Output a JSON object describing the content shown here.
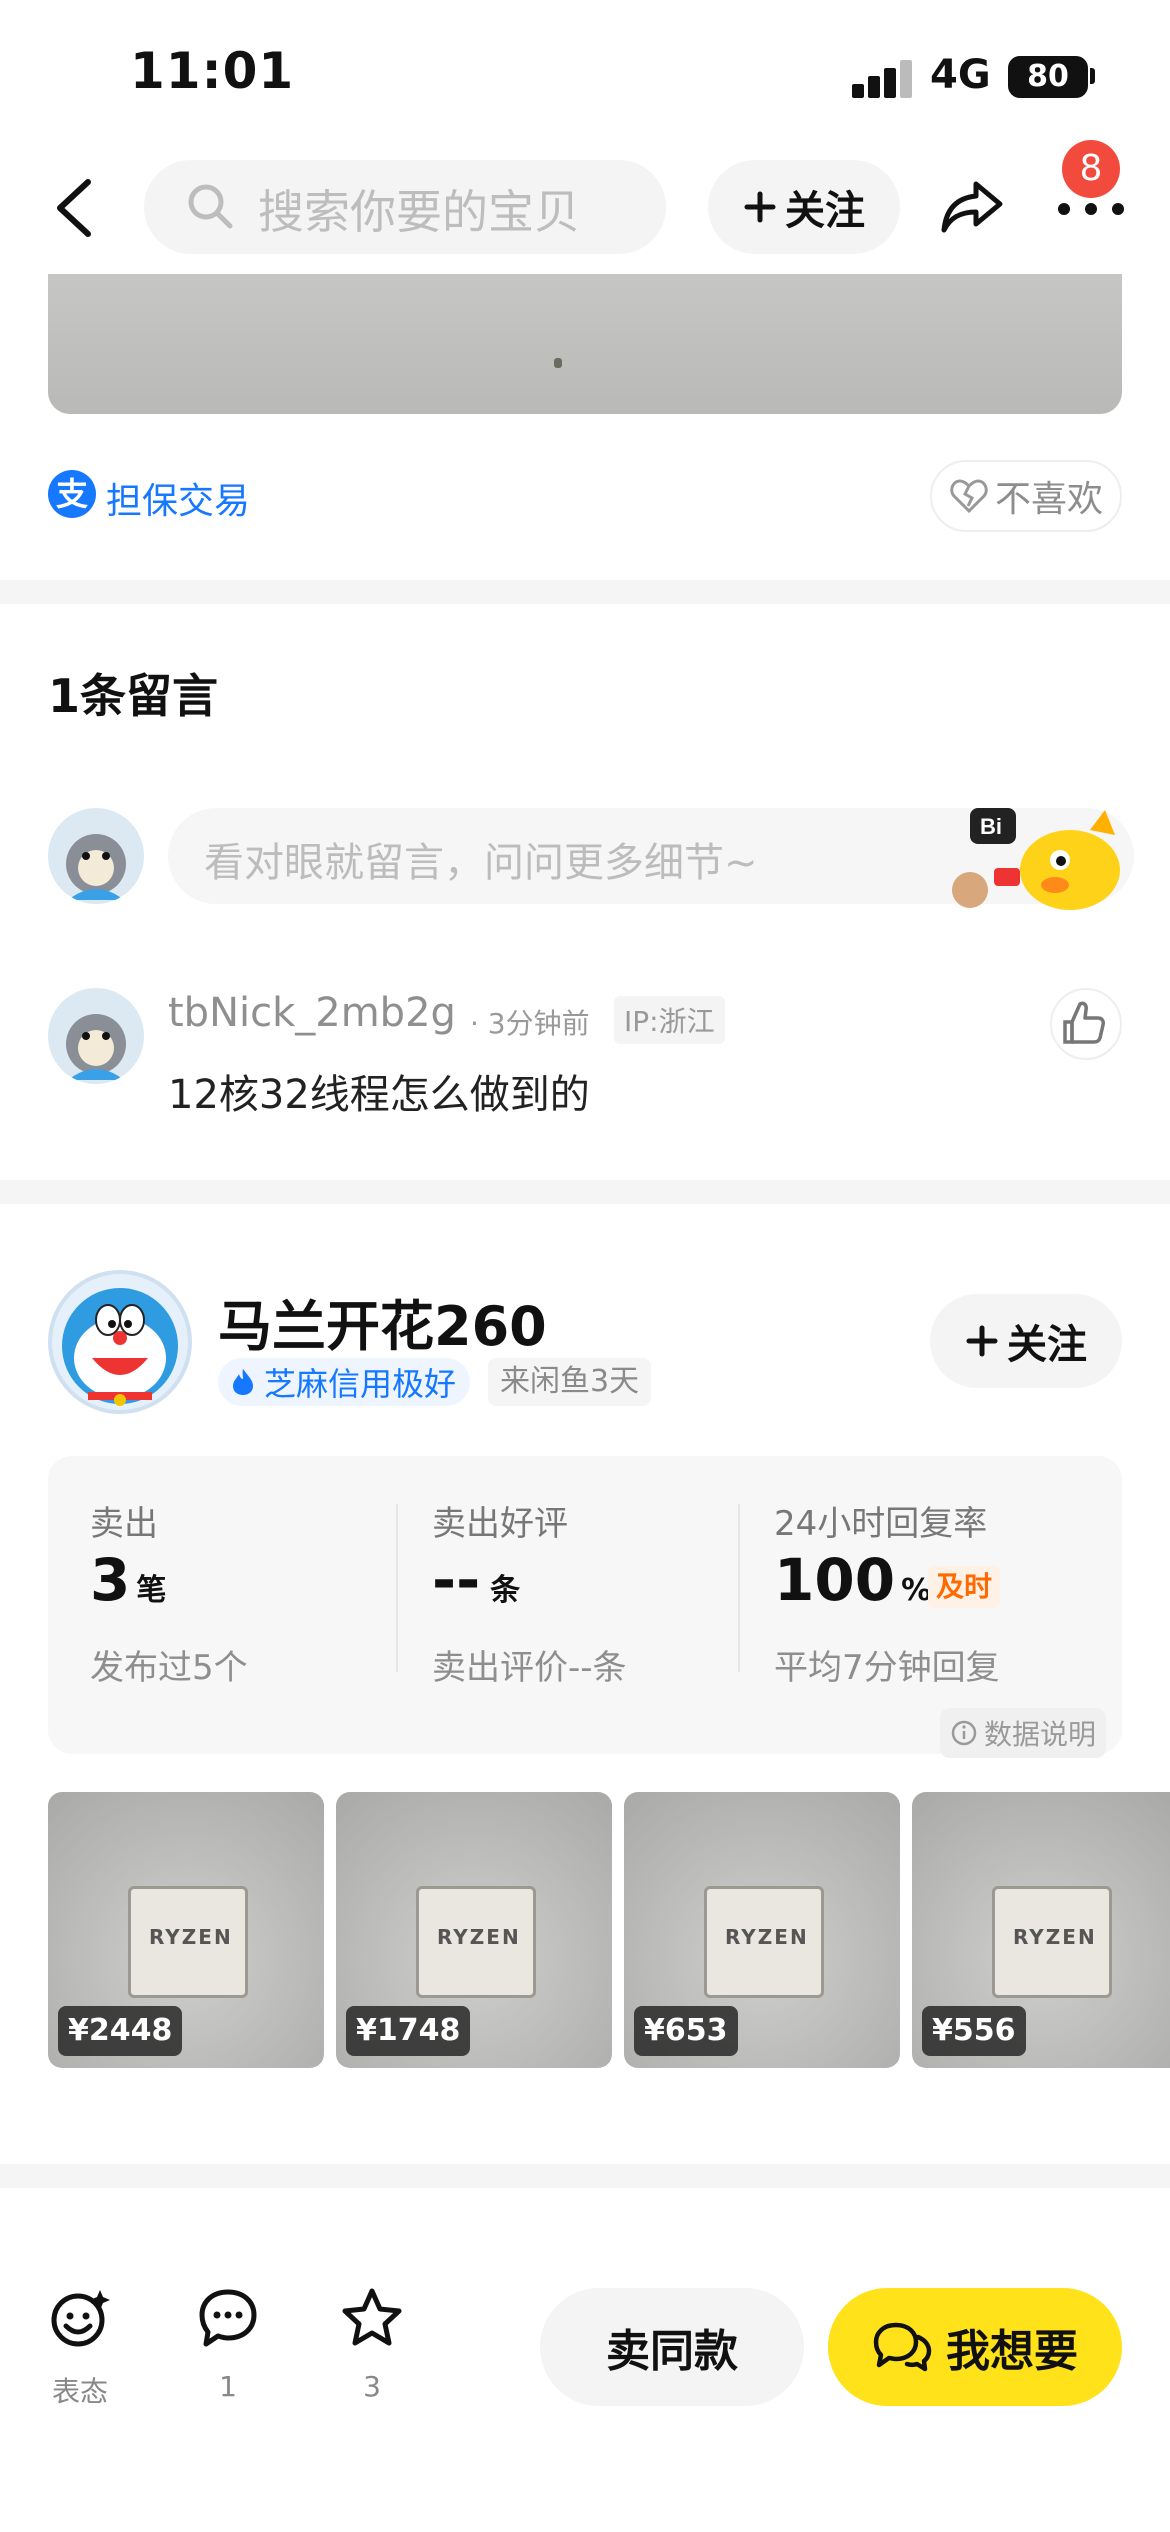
{
  "status_bar": {
    "time": "11:01",
    "network": "4G",
    "battery": "80"
  },
  "nav": {
    "search_placeholder": "搜索你要的宝贝",
    "follow_label": "关注",
    "notification_count": "8"
  },
  "item": {
    "guarantee_label": "担保交易",
    "dislike_label": "不喜欢"
  },
  "comments": {
    "title": "1条留言",
    "input_placeholder": "看对眼就留言，问问更多细节~",
    "list": [
      {
        "user": "tbNick_2mb2g",
        "time": "· 3分钟前",
        "ip": "IP:浙江",
        "text": "12核32线程怎么做到的"
      }
    ]
  },
  "seller": {
    "name": "马兰开花260",
    "credit": "芝麻信用极好",
    "since": "来闲鱼3天",
    "follow_label": "关注",
    "stats": [
      {
        "label": "卖出",
        "value": "3",
        "unit": "笔",
        "sub": "发布过5个"
      },
      {
        "label": "卖出好评",
        "value": "--",
        "unit": "条",
        "sub": "卖出评价--条"
      },
      {
        "label": "24小时回复率",
        "value": "100",
        "unit": "%",
        "tag": "及时",
        "sub": "平均7分钟回复"
      }
    ],
    "data_note": "数据说明"
  },
  "products": [
    {
      "price": "¥2448",
      "logo": "RYZEN"
    },
    {
      "price": "¥1748",
      "logo": "RYZEN"
    },
    {
      "price": "¥653",
      "logo": "RYZEN"
    },
    {
      "price": "¥556",
      "logo": "RYZEN"
    }
  ],
  "bottom_bar": {
    "react_label": "表态",
    "comment_count": "1",
    "favorite_count": "3",
    "same_label": "卖同款",
    "want_label": "我想要"
  },
  "colors": {
    "accent_yellow": "#ffe21a",
    "alipay_blue": "#1677ff",
    "badge_red": "#f24b3d",
    "ontime_orange": "#ff6a00"
  }
}
